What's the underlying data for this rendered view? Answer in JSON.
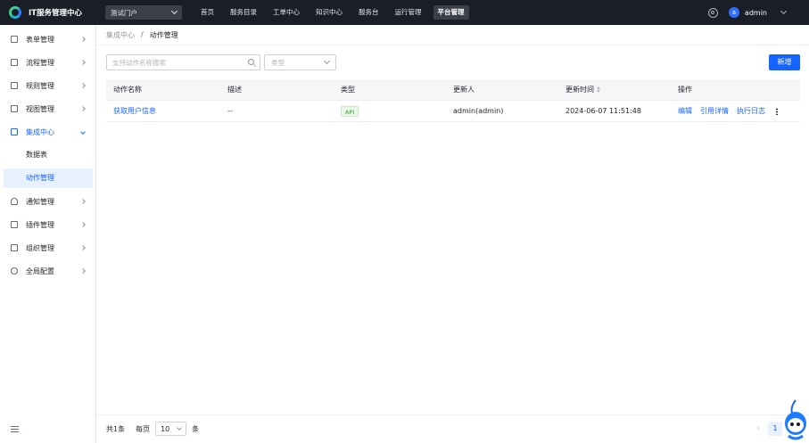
{
  "app": {
    "title": "IT服务管理中心",
    "portal_select": "测试门户"
  },
  "nav": {
    "items": [
      "首页",
      "服务目录",
      "工单中心",
      "知识中心",
      "服务台",
      "运行管理",
      "平台管理"
    ],
    "active_index": 6
  },
  "user": {
    "avatar_letter": "a",
    "name": "admin"
  },
  "sidebar": {
    "items": [
      {
        "label": "表单管理",
        "icon": "form-icon"
      },
      {
        "label": "流程管理",
        "icon": "flow-icon"
      },
      {
        "label": "规则管理",
        "icon": "rule-icon"
      },
      {
        "label": "视图管理",
        "icon": "view-icon"
      },
      {
        "label": "集成中心",
        "icon": "integration-icon",
        "expanded": true
      },
      {
        "label": "通知管理",
        "icon": "bell-icon"
      },
      {
        "label": "插件管理",
        "icon": "plugin-icon"
      },
      {
        "label": "组织管理",
        "icon": "org-icon"
      },
      {
        "label": "全局配置",
        "icon": "settings-icon"
      }
    ],
    "sub_items": [
      {
        "label": "数据表",
        "active": false
      },
      {
        "label": "动作管理",
        "active": true
      }
    ]
  },
  "breadcrumb": {
    "parent": "集成中心",
    "separator": "/",
    "current": "动作管理"
  },
  "toolbar": {
    "search_placeholder": "支持动作名称搜索",
    "type_placeholder": "类型",
    "add_label": "新增"
  },
  "table": {
    "columns": [
      "动作名称",
      "描述",
      "类型",
      "更新人",
      "更新时间",
      "操作"
    ],
    "rows": [
      {
        "name": "获取用户信息",
        "description": "--",
        "type": "API",
        "updater": "admin(admin)",
        "updated_at": "2024-06-07 11:51:48",
        "actions": [
          "编辑",
          "引用详情",
          "执行日志"
        ]
      }
    ]
  },
  "footer": {
    "total_label": "共1条",
    "per_page_label": "每页",
    "per_page_value": "10",
    "unit_label": "条",
    "current_page": "1"
  },
  "colors": {
    "primary": "#1664ff",
    "topbar": "#1a1e26",
    "tag_green": "#2ea121"
  }
}
